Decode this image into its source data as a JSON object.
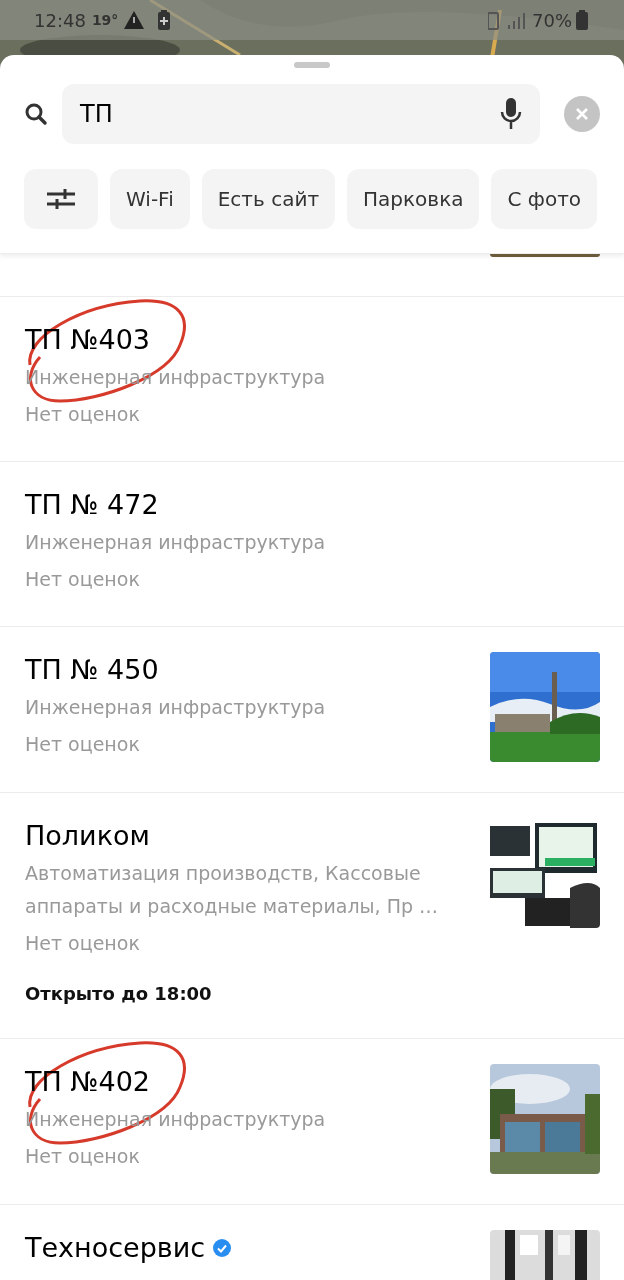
{
  "status_bar": {
    "time": "12:48",
    "temperature": "19°",
    "battery": "70%"
  },
  "search": {
    "value": "ТП"
  },
  "filters": [
    {
      "kind": "settings"
    },
    {
      "kind": "chip",
      "label": "Wi-Fi"
    },
    {
      "kind": "chip",
      "label": "Есть сайт"
    },
    {
      "kind": "chip",
      "label": "Парковка"
    },
    {
      "kind": "chip",
      "label": "С фото"
    }
  ],
  "results": [
    {
      "title": "ТП №403",
      "category": "Инженерная инфраструктура",
      "rating": "Нет оценок",
      "marked": true
    },
    {
      "title": "ТП № 472",
      "category": "Инженерная инфраструктура",
      "rating": "Нет оценок",
      "marked": false
    },
    {
      "title": "ТП № 450",
      "category": "Инженерная инфраструктура",
      "rating": "Нет оценок",
      "marked": false,
      "photo": true
    },
    {
      "title": "Поликом",
      "category": "Автоматизация производств, Кассовые аппараты и расходные материалы, Пр …",
      "rating": "Нет оценок",
      "hours": "Открыто до 18:00",
      "marked": false,
      "photo": true
    },
    {
      "title": "ТП №402",
      "category": "Инженерная инфраструктура",
      "rating": "Нет оценок",
      "marked": true,
      "photo": true
    },
    {
      "title": "Техносервис",
      "verified": true,
      "marked": false,
      "photo": true
    }
  ]
}
